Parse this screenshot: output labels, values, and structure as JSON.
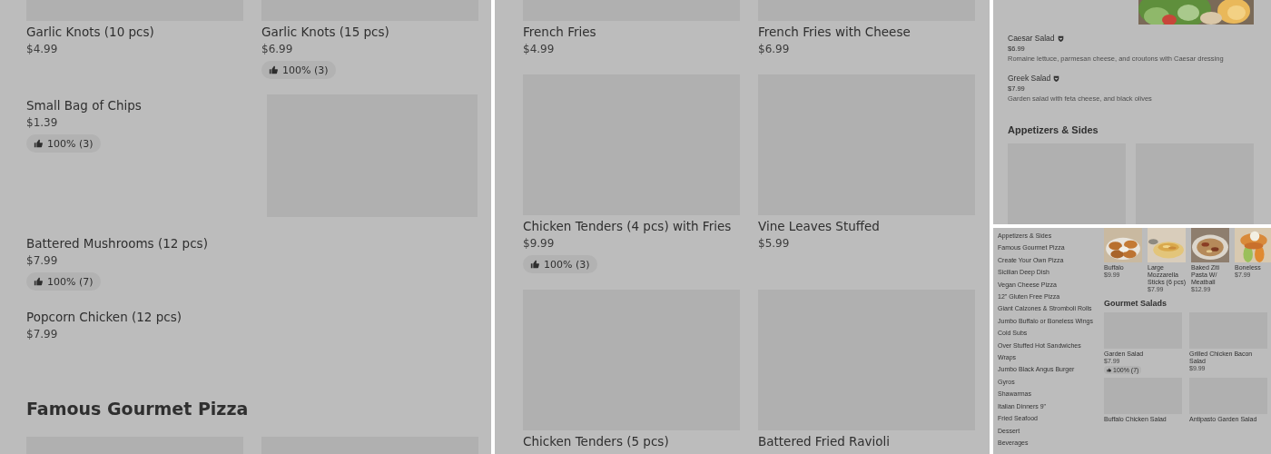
{
  "appetizers_view": {
    "blocks": [
      {
        "kind": "row",
        "items": [
          {
            "kind": "with_image",
            "name": "Garlic Knots (10 pcs)",
            "price": "$4.99"
          },
          {
            "kind": "with_image",
            "name": "Garlic Knots (15 pcs)",
            "price": "$6.99",
            "rating": "100% (3)"
          }
        ]
      },
      {
        "kind": "row",
        "items": [
          {
            "kind": "text_only",
            "name": "Small Bag of Chips",
            "price": "$1.39",
            "rating": "100% (3)"
          },
          {
            "kind": "with_image"
          }
        ]
      },
      {
        "kind": "row",
        "items": [
          {
            "kind": "text_only",
            "name": "Battered Mushrooms (12 pcs)",
            "price": "$7.99",
            "rating": "100% (7)"
          }
        ]
      },
      {
        "kind": "row",
        "items": [
          {
            "kind": "text_only",
            "name": "Popcorn Chicken (12 pcs)",
            "price": "$7.99"
          }
        ]
      },
      {
        "kind": "heading",
        "text": "Famous Gourmet Pizza"
      },
      {
        "kind": "row",
        "items": [
          {
            "kind": "with_image"
          },
          {
            "kind": "with_image"
          }
        ]
      }
    ]
  },
  "sides_view": {
    "blocks": [
      {
        "kind": "row",
        "items": [
          {
            "kind": "with_image",
            "name": "French Fries",
            "price": "$4.99"
          },
          {
            "kind": "with_image",
            "name": "French Fries with Cheese",
            "price": "$6.99"
          }
        ]
      },
      {
        "kind": "row",
        "items": [
          {
            "kind": "with_image",
            "name": "Chicken Tenders (4 pcs) with Fries",
            "price": "$9.99",
            "rating": "100% (3)"
          },
          {
            "kind": "with_image",
            "name": "Vine Leaves Stuffed",
            "price": "$5.99"
          }
        ]
      },
      {
        "kind": "row",
        "items": [
          {
            "kind": "with_image",
            "name": "Chicken Tenders (5 pcs)"
          },
          {
            "kind": "with_image",
            "name": "Battered Fried Ravioli"
          }
        ]
      }
    ]
  },
  "salads_view": {
    "items": [
      {
        "name": "Caesar Salad",
        "price": "$6.99",
        "description": "Romaine lettuce, parmesan cheese, and croutons with Caesar dressing"
      },
      {
        "name": "Greek Salad",
        "price": "$7.99",
        "description": "Garden salad with feta cheese, and black olives"
      }
    ],
    "heading": "Appetizers & Sides",
    "placeholders": [
      {
        "kind": "placeholder"
      },
      {
        "kind": "placeholder"
      }
    ]
  },
  "category_view": {
    "sidebar": {
      "items": [
        "Appetizers & Sides",
        "Famous Gourmet Pizza",
        "Create Your Own Pizza",
        "Sicilian Deep Dish",
        "Vegan Cheese Pizza",
        "12\" Gluten Free Pizza",
        "Giant Calzones & Stromboli Rolls",
        "Jumbo Buffalo or Boneless Wings",
        "Cold Subs",
        "Over Stuffed Hot Sandwiches",
        "Wraps",
        "Jumbo Black Angus Burger",
        "Gyros",
        "Shawarmas",
        "Italian Dinners 9\"",
        "Fried Seafood",
        "Dessert",
        "Beverages"
      ]
    },
    "photo_items": [
      {
        "name": "Buffalo",
        "price": "$9.99"
      },
      {
        "name": "Large Mozzarella Sticks (6 pcs)",
        "price": "$7.99"
      },
      {
        "name": "Baked Ziti Pasta W/ Meatball",
        "price": "$12.99"
      },
      {
        "name": "Boneless",
        "price": "$7.99"
      }
    ],
    "heading": "Gourmet Salads",
    "salads": [
      {
        "name": "Garden Salad",
        "price": "$7.99",
        "rating": "100% (7)"
      },
      {
        "name": "Grilled Chicken Bacon Salad",
        "price": "$9.99"
      },
      {
        "name": "Buffalo Chicken Salad"
      },
      {
        "name": "Antipasto Garden Salad"
      }
    ]
  }
}
